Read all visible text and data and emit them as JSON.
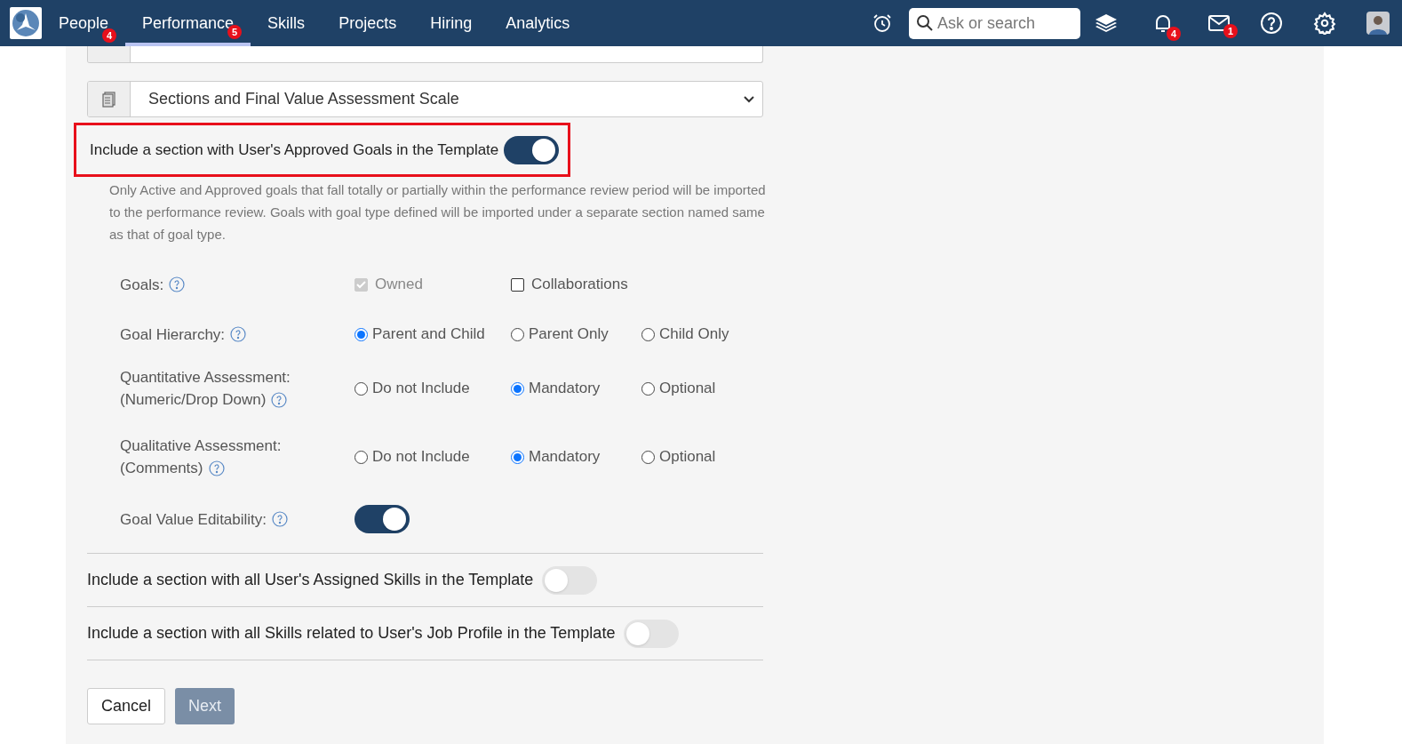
{
  "nav": {
    "items": [
      {
        "label": "People",
        "selected": false,
        "badge": "4"
      },
      {
        "label": "Performance",
        "selected": true,
        "badge": "5"
      },
      {
        "label": "Skills",
        "selected": false
      },
      {
        "label": "Projects",
        "selected": false
      },
      {
        "label": "Hiring",
        "selected": false
      },
      {
        "label": "Analytics",
        "selected": false
      }
    ],
    "search": {
      "placeholder": "Ask or search"
    },
    "icons": [
      {
        "kind": "alarm"
      },
      {
        "kind": "search"
      },
      {
        "kind": "layers"
      },
      {
        "kind": "bell",
        "badge": "4"
      },
      {
        "kind": "mail",
        "badge": "1"
      },
      {
        "kind": "help"
      },
      {
        "kind": "settings"
      },
      {
        "kind": "avatar"
      }
    ]
  },
  "template_selects": [
    {
      "value": "Sections and Final Value Assessment Scale"
    }
  ],
  "goals_section": {
    "label": "Include a section with User's Approved Goals in the Template",
    "on": true,
    "highlighted": true,
    "note": "Only Active and Approved goals that fall totally or partially within the performance review period will be imported to the performance review. Goals with goal type defined will be imported under a separate section named same as that of goal type.",
    "options": [
      {
        "kind": "checkbox",
        "label": [
          "Goals:"
        ],
        "choices": [
          {
            "label": "Owned",
            "checked": true,
            "disabled": true
          },
          {
            "label": "Collaborations",
            "checked": false,
            "disabled": false
          }
        ]
      },
      {
        "kind": "radio",
        "label": [
          "Goal Hierarchy:"
        ],
        "choices": [
          {
            "label": "Parent and Child",
            "selected": true
          },
          {
            "label": "Parent Only",
            "selected": false
          },
          {
            "label": "Child Only",
            "selected": false
          }
        ]
      },
      {
        "kind": "radio",
        "label": [
          "Quantitative Assessment:",
          "(Numeric/Drop Down)"
        ],
        "choices": [
          {
            "label": "Do not Include",
            "selected": false
          },
          {
            "label": "Mandatory",
            "selected": true
          },
          {
            "label": "Optional",
            "selected": false
          }
        ]
      },
      {
        "kind": "radio",
        "label": [
          "Qualitative Assessment:",
          "(Comments)"
        ],
        "choices": [
          {
            "label": "Do not Include",
            "selected": false
          },
          {
            "label": "Mandatory",
            "selected": true
          },
          {
            "label": "Optional",
            "selected": false
          }
        ]
      },
      {
        "kind": "toggle",
        "label": [
          "Goal Value Editability:"
        ],
        "on": true
      }
    ]
  },
  "skill_sections": [
    {
      "label": "Include a section with all User's Assigned Skills in the Template",
      "on": false
    },
    {
      "label": "Include a section with all Skills related to User's Job Profile in the Template",
      "on": false
    }
  ],
  "buttons": [
    {
      "label": "Cancel",
      "kind": "secondary",
      "disabled": false
    },
    {
      "label": "Next",
      "kind": "primary",
      "disabled": true
    }
  ]
}
